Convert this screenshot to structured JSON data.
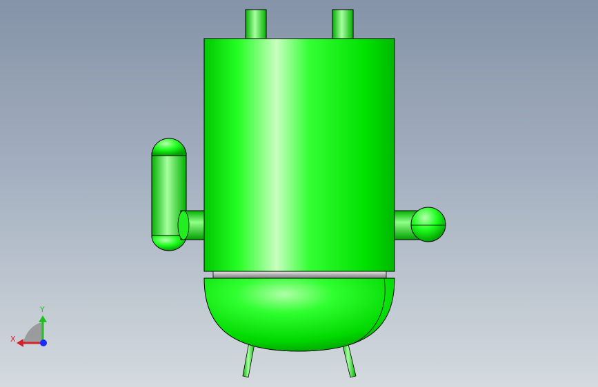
{
  "viewport": {
    "background_top": "#8593a8",
    "background_bottom": "#d4dade"
  },
  "model": {
    "body_color": "#00ff00",
    "highlight_color": "#c8ffc0",
    "shadow_color": "#00a800",
    "band_color": "#b8b8b8",
    "edge_color": "#000000"
  },
  "triad": {
    "x_label": "X",
    "y_label": "Y",
    "x_color": "#d8202a",
    "y_color": "#20c020",
    "z_color": "#1a2bff"
  }
}
